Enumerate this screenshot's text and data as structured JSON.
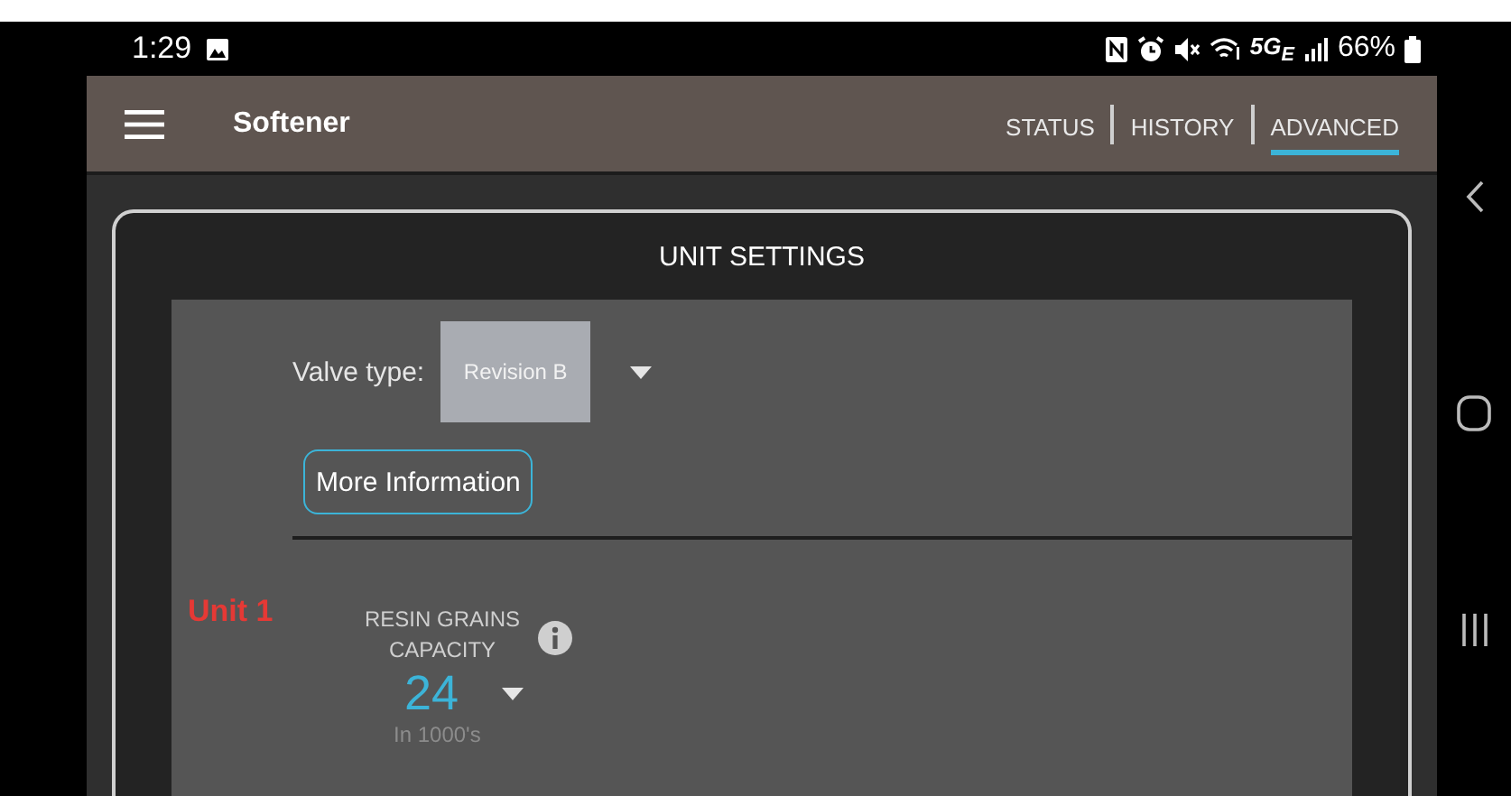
{
  "status_bar": {
    "time": "1:29",
    "network": "5G$_{E}$",
    "battery": "66%"
  },
  "app_bar": {
    "title": "Softener",
    "tabs": [
      {
        "label": "STATUS",
        "selected": false
      },
      {
        "label": "HISTORY",
        "selected": false
      },
      {
        "label": "ADVANCED",
        "selected": true
      }
    ]
  },
  "card": {
    "title": "UNIT SETTINGS",
    "valve_type": {
      "label": "Valve type:",
      "value": "Revision B"
    },
    "more_button": "More Information",
    "unit": {
      "label": "Unit 1",
      "setting_label": "RESIN GRAINS CAPACITY",
      "value": "24",
      "hint": "In 1000's"
    }
  }
}
